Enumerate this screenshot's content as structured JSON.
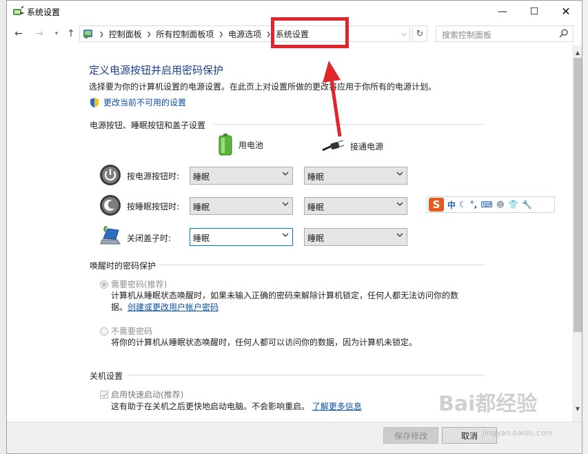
{
  "window": {
    "title": "系统设置",
    "controls": {
      "minimize": "—",
      "maximize": "☐",
      "close": "✕"
    }
  },
  "nav": {
    "breadcrumb": [
      "控制面板",
      "所有控制面板项",
      "电源选项",
      "系统设置"
    ],
    "search_placeholder": "搜索控制面板"
  },
  "page": {
    "heading": "定义电源按钮并启用密码保护",
    "description": "选择要为你的计算机设置的电源设置。在此页上对设置所做的更改将应用于你所有的电源计划。",
    "admin_link": "更改当前不可用的设置"
  },
  "buttons_section": {
    "title": "电源按钮、睡眠按钮和盖子设置",
    "col_battery": "用电池",
    "col_plugged": "接通电源",
    "rows": [
      {
        "label": "按电源按钮时:",
        "battery": "睡眠",
        "plugged": "睡眠"
      },
      {
        "label": "按睡眠按钮时:",
        "battery": "睡眠",
        "plugged": "睡眠"
      },
      {
        "label": "关闭盖子时:",
        "battery": "睡眠",
        "plugged": "睡眠"
      }
    ]
  },
  "password_section": {
    "title": "唤醒时的密码保护",
    "require_label": "需要密码(推荐)",
    "require_desc_line1": "计算机从睡眠状态唤醒时，如果未输入正确的密码来解除计算机锁定，任何人都无法访问你的数",
    "require_desc_line2_prefix": "据。",
    "require_link": "创建或更改用户帐户密码",
    "none_label": "不需要密码",
    "none_desc": "将你的计算机从睡眠状态唤醒时，任何人都可以访问你的数据，因为计算机未锁定。"
  },
  "shutdown_section": {
    "title": "关机设置",
    "fast_startup_label": "启用快速启动(推荐)",
    "fast_startup_desc": "这有助于在关机之后更快地启动电脑。不会影响重启。",
    "learn_more": "了解更多信息"
  },
  "footer": {
    "save": "保存修改",
    "cancel": "取消"
  },
  "ime": {
    "logo": "S",
    "mode": "中"
  },
  "watermark": {
    "text": "Bai都经验",
    "url": "jingyan.baidu.com"
  },
  "colors": {
    "heading": "#1e3f8c",
    "link": "#0b4fa6",
    "annotation_red": "#e0262d"
  }
}
